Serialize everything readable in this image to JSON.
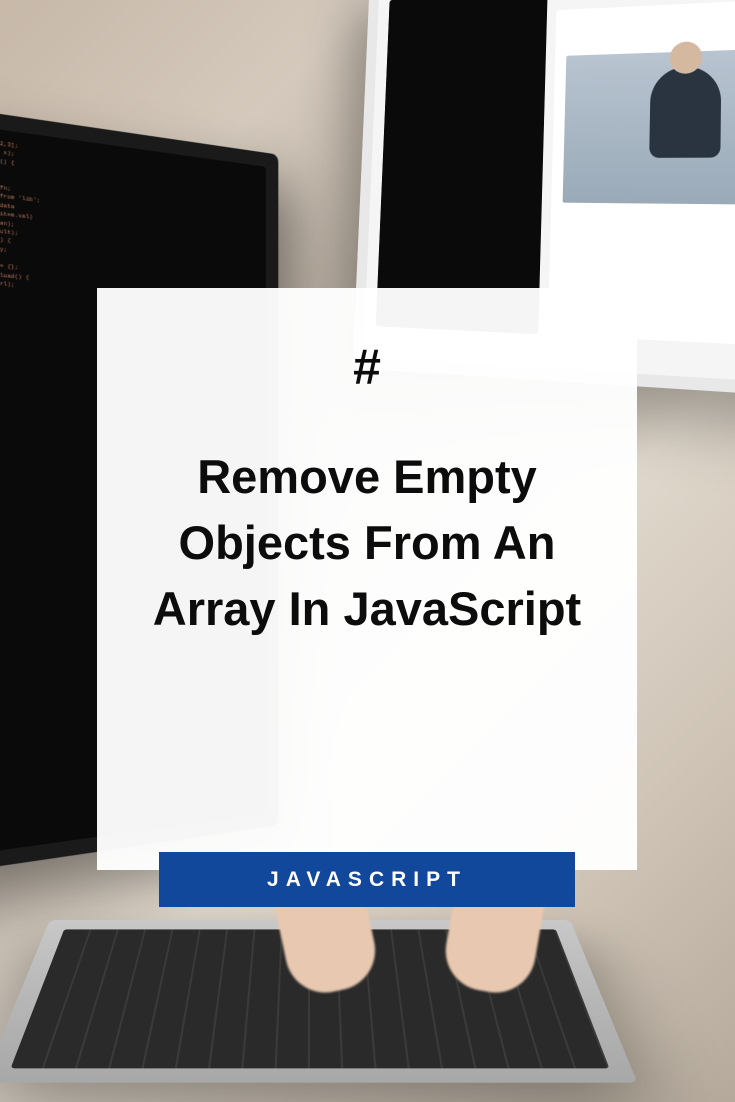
{
  "card": {
    "hash_symbol": "#",
    "title": "Remove Empty Objects From An Array In JavaScript"
  },
  "category": {
    "label": "JAVASCRIPT"
  },
  "colors": {
    "badge_bg": "#11489c",
    "badge_text": "#ffffff",
    "card_bg": "rgba(255,255,255,0.96)",
    "title_color": "#0c0c0c"
  }
}
